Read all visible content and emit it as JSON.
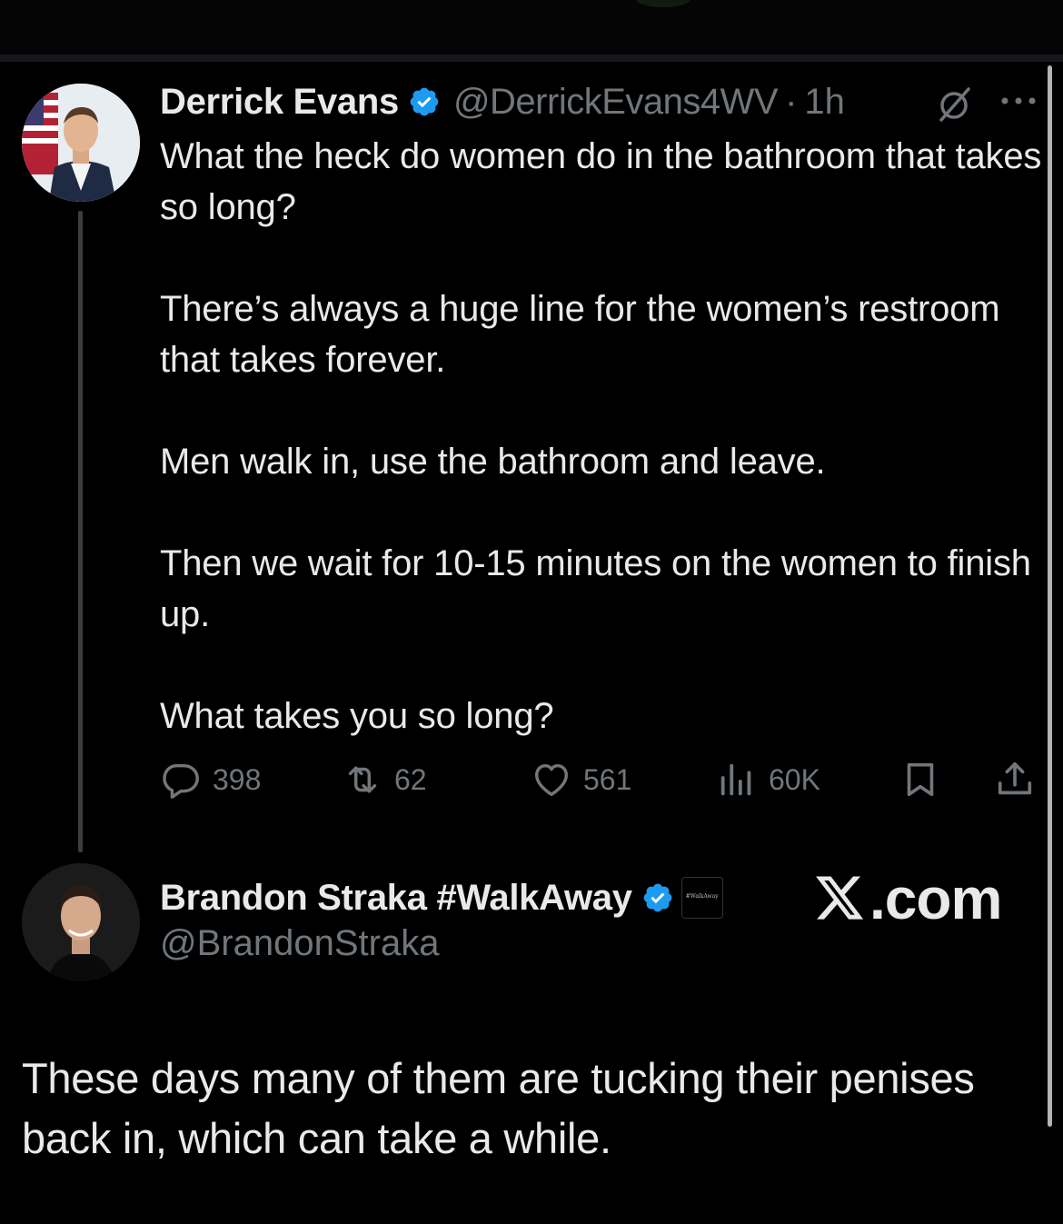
{
  "tweet": {
    "author_name": "Derrick Evans",
    "handle": "@DerrickEvans4WV",
    "separator": "·",
    "time": "1h",
    "paragraphs": [
      "What the heck do women do in the bathroom that takes so long?",
      "There’s always a huge line for the women’s restroom that takes forever.",
      "Men walk in, use the bathroom and leave.",
      "Then we wait for 10-15 minutes on the women to finish up.",
      "What takes you so long?"
    ],
    "stats": {
      "replies": "398",
      "reposts": "62",
      "likes": "561",
      "views": "60K"
    }
  },
  "reply": {
    "author_name": "Brandon Straka #WalkAway",
    "handle": "@BrandonStraka",
    "affiliate_badge_text": "#WalkAway",
    "text": "These days many of them are tucking their penises back in, which can take a while."
  },
  "watermark": {
    "domain_text": ".com"
  },
  "icons": {
    "verified": "verified-badge-icon",
    "grok": "grok-icon",
    "more": "more-icon",
    "reply": "reply-icon",
    "repost": "repost-icon",
    "like": "like-icon",
    "views": "views-icon",
    "bookmark": "bookmark-icon",
    "share": "share-icon"
  },
  "colors": {
    "background": "#000000",
    "text": "#e7e9ea",
    "secondary_text": "#71767b",
    "verified_blue": "#1d9bf0"
  }
}
